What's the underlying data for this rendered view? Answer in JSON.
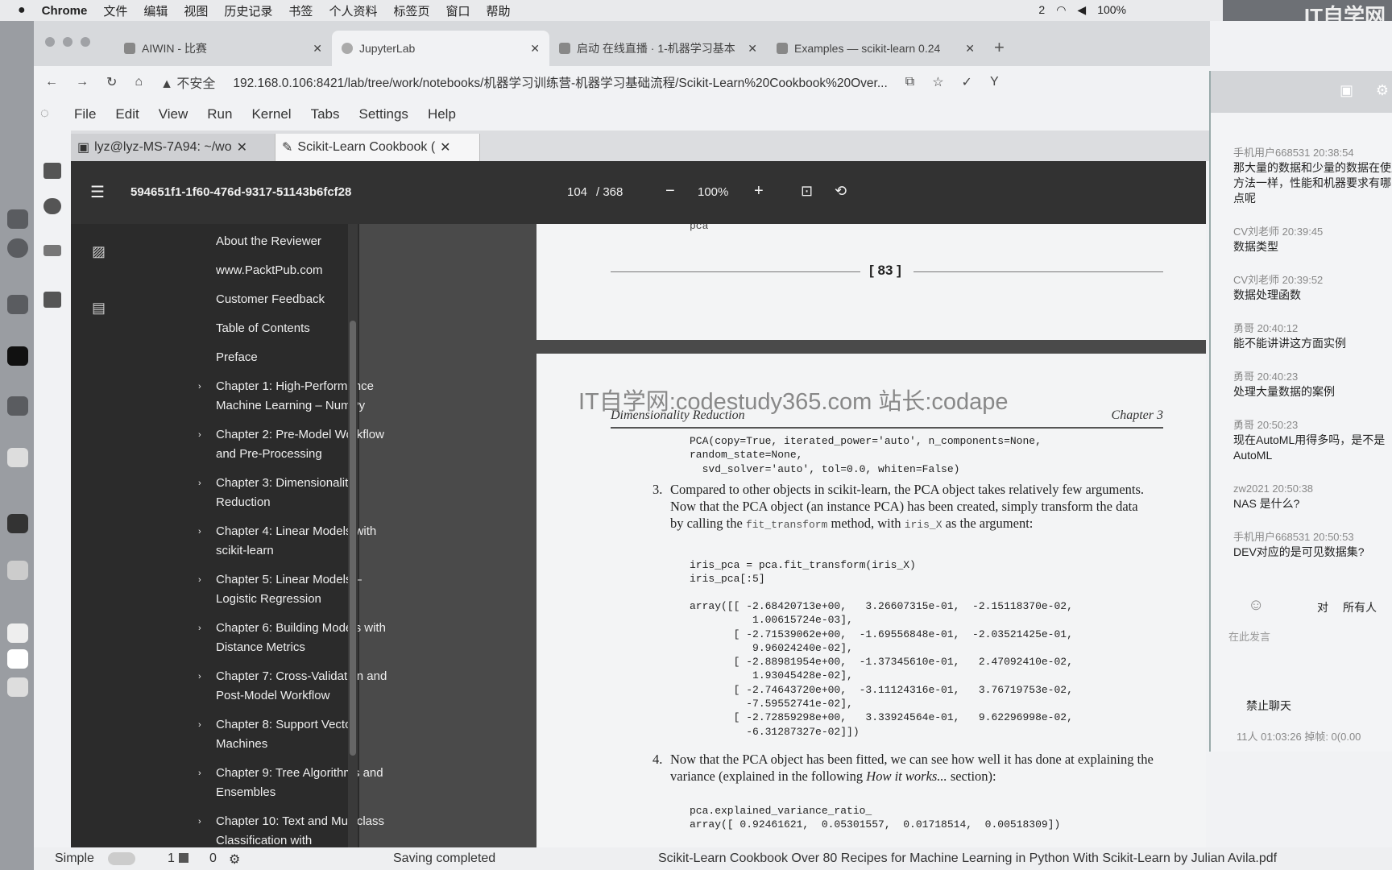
{
  "mac_menu": {
    "app": "Chrome",
    "items": [
      "文件",
      "编辑",
      "视图",
      "历史记录",
      "书签",
      "个人资料",
      "标签页",
      "窗口",
      "帮助"
    ],
    "tray": [
      "2",
      "100%"
    ]
  },
  "watermark": {
    "title": "IT自学网",
    "site": "codestudy365.com"
  },
  "chrome": {
    "tabs": [
      {
        "title": "AIWIN - 比赛"
      },
      {
        "title": "JupyterLab"
      },
      {
        "title": "启动 在线直播 · 1-机器学习基本"
      },
      {
        "title": "Examples — scikit-learn 0.24"
      }
    ],
    "new_tab": "+",
    "security": "不安全",
    "url": "192.168.0.106:8421/lab/tree/work/notebooks/机器学习训练营-机器学习基础流程/Scikit-Learn%20Cookbook%20Over..."
  },
  "jupyter": {
    "menu": [
      "File",
      "Edit",
      "View",
      "Run",
      "Kernel",
      "Tabs",
      "Settings",
      "Help"
    ],
    "tabs": [
      {
        "title": "lyz@lyz-MS-7A94: ~/wo"
      },
      {
        "title": "Scikit-Learn Cookbook ("
      }
    ]
  },
  "viewer": {
    "doc_id": "594651f1-1f60-476d-9317-51143b6fcf28",
    "page": "104",
    "pages": "/ 368",
    "zoom": "100%",
    "minus": "−",
    "plus": "+"
  },
  "outline": [
    {
      "label": "About the Reviewer",
      "chapter": false
    },
    {
      "label": "www.PacktPub.com",
      "chapter": false
    },
    {
      "label": "Customer Feedback",
      "chapter": false
    },
    {
      "label": "Table of Contents",
      "chapter": false
    },
    {
      "label": "Preface",
      "chapter": false
    },
    {
      "label": "Chapter 1: High-Performance Machine Learning – NumPy",
      "chapter": true
    },
    {
      "label": "Chapter 2: Pre-Model Workflow and Pre-Processing",
      "chapter": true
    },
    {
      "label": "Chapter 3: Dimensionality Reduction",
      "chapter": true
    },
    {
      "label": "Chapter 4: Linear Models with scikit-learn",
      "chapter": true
    },
    {
      "label": "Chapter 5: Linear Models – Logistic Regression",
      "chapter": true
    },
    {
      "label": "Chapter 6: Building Models with Distance Metrics",
      "chapter": true
    },
    {
      "label": "Chapter 7: Cross-Validation and Post-Model Workflow",
      "chapter": true
    },
    {
      "label": "Chapter 8: Support Vector Machines",
      "chapter": true
    },
    {
      "label": "Chapter 9: Tree Algorithms and Ensembles",
      "chapter": true
    },
    {
      "label": "Chapter 10: Text and Multiclass Classification with",
      "chapter": true
    }
  ],
  "pdf": {
    "page1_top": "pca",
    "page1_number": "[ 83 ]",
    "watermark": "IT自学网:codestudy365.com 站长:codape",
    "header_left": "Dimensionality Reduction",
    "header_right": "Chapter 3",
    "code1": "PCA(copy=True, iterated_power='auto', n_components=None,\nrandom_state=None,\n  svd_solver='auto', tol=0.0, whiten=False)",
    "step3_num": "3.",
    "step3_a": "Compared to other objects in scikit-learn, the PCA object takes relatively few arguments. Now that the PCA object (an instance PCA) has been created, simply transform the data by calling the ",
    "step3_code1": "fit_transform",
    "step3_b": " method, with ",
    "step3_code2": "iris_X",
    "step3_c": " as the argument:",
    "code2": "iris_pca = pca.fit_transform(iris_X)\niris_pca[:5]",
    "code3": "array([[ -2.68420713e+00,   3.26607315e-01,  -2.15118370e-02,\n          1.00615724e-03],\n       [ -2.71539062e+00,  -1.69556848e-01,  -2.03521425e-01,\n          9.96024240e-02],\n       [ -2.88981954e+00,  -1.37345610e-01,   2.47092410e-02,\n          1.93045428e-02],\n       [ -2.74643720e+00,  -3.11124316e-01,   3.76719753e-02,\n         -7.59552741e-02],\n       [ -2.72859298e+00,   3.33924564e-01,   9.62296998e-02,\n         -6.31287327e-02]])",
    "step4_num": "4.",
    "step4_a": "Now that the PCA object has been fitted, we can see how well it has done at explaining the variance (explained in the following ",
    "step4_em": "How it works...",
    "step4_b": " section):",
    "code4": "pca.explained_variance_ratio_\narray([ 0.92461621,  0.05301557,  0.01718514,  0.00518309])"
  },
  "chat": {
    "messages": [
      {
        "who": "手机用户668531 20:38:54",
        "text": "那大量的数据和少量的数据在使用",
        "text2": "方法一样，性能和机器要求有哪",
        "text3": "点呢"
      },
      {
        "who": "CV刘老师 20:39:45",
        "text": "数据类型"
      },
      {
        "who": "CV刘老师 20:39:52",
        "text": "数据处理函数"
      },
      {
        "who": "勇哥 20:40:12",
        "text": "能不能讲讲这方面实例"
      },
      {
        "who": "勇哥 20:40:23",
        "text": "处理大量数据的案例"
      },
      {
        "who": "勇哥 20:50:23",
        "text": "现在AutoML用得多吗，是不是",
        "text2": "AutoML"
      },
      {
        "who": "zw2021 20:50:38",
        "text": "NAS 是什么?"
      },
      {
        "who": "手机用户668531 20:50:53",
        "text": "DEV对应的是可见数据集?"
      }
    ],
    "to": "对",
    "all": "所有人",
    "placeholder": "在此发言",
    "mute": "禁止聊天",
    "footer": "11人  01:03:26  掉帧: 0(0.00"
  },
  "status": {
    "mode": "Simple",
    "kernels": "1",
    "terminals": "0",
    "saving": "Saving completed",
    "doc_title": "Scikit-Learn Cookbook Over 80 Recipes for Machine Learning in Python With Scikit-Learn by Julian Avila.pdf"
  }
}
